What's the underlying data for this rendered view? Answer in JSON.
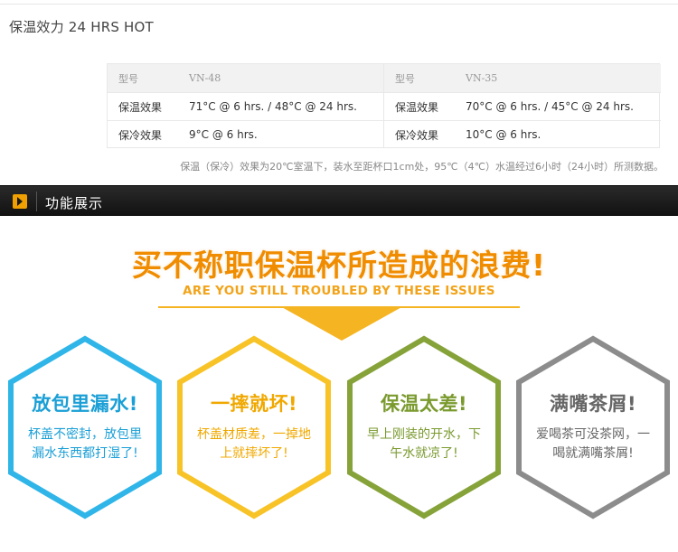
{
  "specs": {
    "title": "保温效力 24 HRS HOT",
    "left": {
      "header_label": "型号",
      "model": "VN-48",
      "rows": [
        {
          "label": "保温效果",
          "value": "71°C @ 6 hrs. / 48°C @ 24 hrs."
        },
        {
          "label": "保冷效果",
          "value": "9°C @ 6 hrs."
        }
      ]
    },
    "right": {
      "header_label": "型号",
      "model": "VN-35",
      "rows": [
        {
          "label": "保温效果",
          "value": "70°C @ 6 hrs. / 45°C @ 24 hrs."
        },
        {
          "label": "保冷效果",
          "value": "10°C @ 6 hrs."
        }
      ]
    },
    "note": "保温（保冷）效果为20℃室温下，装水至距杯口1cm处，95℃（4℃）水温经过6小时（24小时）所测数据。"
  },
  "section": {
    "icon": "chevron-right-icon",
    "label": "功能展示"
  },
  "promo": {
    "headline": "买不称职保温杯所造成的浪费!",
    "subline": "ARE YOU STILL TROUBLED BY THESE ISSUES",
    "accent_color": "#f5b421",
    "issues": [
      {
        "title": "放包里漏水!",
        "desc_line1": "杯盖不密封，放包里",
        "desc_line2": "漏水东西都打湿了!",
        "color": "#2fb5e8",
        "text_color": "#1a9fd6"
      },
      {
        "title": "一摔就坏!",
        "desc_line1": "杯盖材质差，一掉地",
        "desc_line2": "上就摔坏了!",
        "color": "#f7c327",
        "text_color": "#f0a800"
      },
      {
        "title": "保温太差!",
        "desc_line1": "早上刚装的开水，下",
        "desc_line2": "午水就凉了!",
        "color": "#86a33a",
        "text_color": "#7a9a2e"
      },
      {
        "title": "满嘴茶屑!",
        "desc_line1": "爱喝茶可没茶网，一",
        "desc_line2": "喝就满嘴茶屑!",
        "color": "#8c8c8c",
        "text_color": "#666666"
      }
    ]
  }
}
